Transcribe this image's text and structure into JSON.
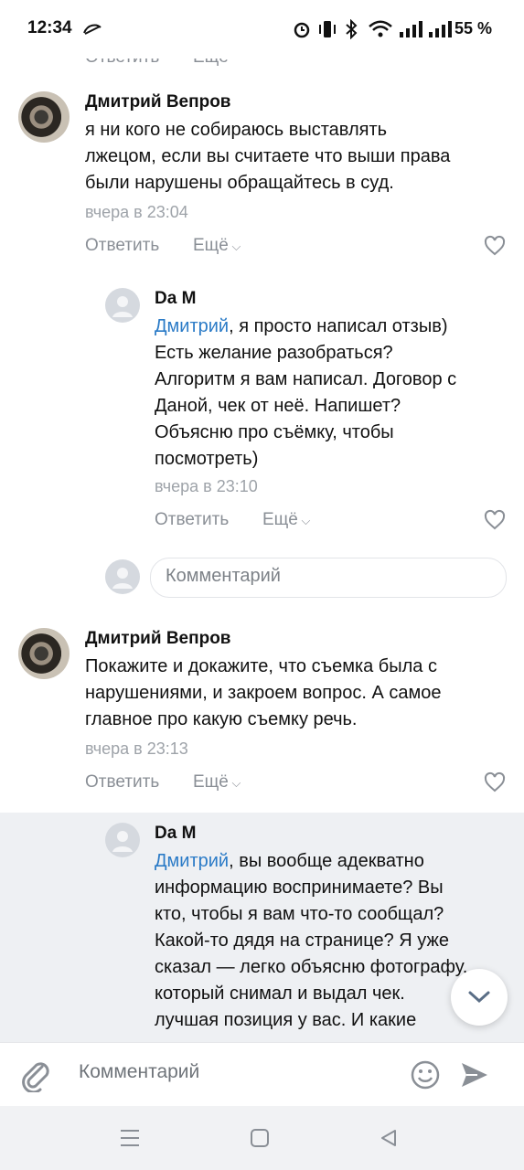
{
  "status_bar": {
    "time": "12:34",
    "battery": "55 %",
    "icons": [
      "dnd-icon",
      "alarm-icon",
      "vibrate-icon",
      "bluetooth-icon",
      "wifi-icon",
      "signal-icon",
      "signal-icon-2"
    ]
  },
  "top_partial": {
    "reply_label": "Ответить",
    "more_label": "Ещё"
  },
  "comments": [
    {
      "author": "Дмитрий Вепров",
      "text": [
        "я ни кого не собираюсь выставлять",
        "лжецом, если вы считаете что выши права",
        "были нарушены обращайтесь в суд."
      ],
      "time": "вчера в 23:04",
      "reply_label": "Ответить",
      "more_label": "Ещё"
    },
    {
      "author": "Da M",
      "mention": "Дмитрий",
      "first_line_rest": ", я просто написал отзыв)",
      "text": [
        "Есть желание разобраться?",
        "Алгоритм я вам написал. Договор с",
        "Даной, чек от неё. Напишет?",
        "Объясню про съёмку, чтобы",
        "посмотреть)"
      ],
      "time": "вчера в 23:10",
      "reply_label": "Ответить",
      "more_label": "Ещё"
    },
    {
      "author": "Дмитрий Вепров",
      "text": [
        "Покажите и докажите, что съемка была с",
        "нарушениями, и закроем вопрос. А самое",
        "главное про какую съемку речь."
      ],
      "time": "вчера в 23:13",
      "reply_label": "Ответить",
      "more_label": "Ещё"
    },
    {
      "author": "Da M",
      "mention": "Дмитрий",
      "first_line_rest": ", вы вообще адекватно",
      "text": [
        "информацию воспринимаете? Вы",
        "кто, чтобы я вам что-то сообщал?",
        "Какой-то дядя на странице? Я уже",
        "сказал — легко объясню фотографу,",
        "который снимал и выдал чек.",
        "лучшая позиция у вас. И какие"
      ]
    }
  ],
  "reply_input": {
    "placeholder": "Комментарий"
  },
  "composer": {
    "placeholder": "Комментарий"
  },
  "colors": {
    "accent": "#2b7bc7",
    "highlight": "#eef0f3",
    "muted": "#8a8f96"
  }
}
